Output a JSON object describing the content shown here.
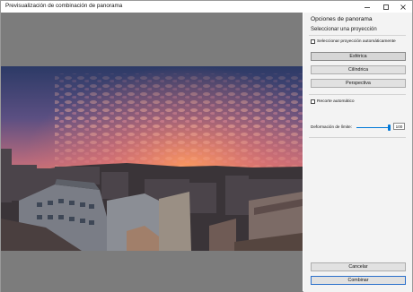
{
  "window": {
    "title": "Previsualización de combinación de panorama"
  },
  "panel": {
    "title": "Opciones de panorama",
    "projection_section": "Seleccionar una proyección",
    "auto_projection_label": "Seleccionar proyección automáticamente",
    "auto_projection_checked": false,
    "projections": [
      {
        "label": "Esférica",
        "selected": true
      },
      {
        "label": "Cilíndrica",
        "selected": false
      },
      {
        "label": "Perspectiva",
        "selected": false
      }
    ],
    "auto_crop_label": "Recorte automático",
    "auto_crop_checked": false,
    "boundary_warp_label": "Deformación de límite:",
    "boundary_warp_value": "100",
    "boundary_warp_fraction": 1.0,
    "cancel_label": "Cancelar",
    "merge_label": "Combinar"
  },
  "colors": {
    "accent": "#0078d7",
    "preview_background": "#7c7c7c"
  }
}
